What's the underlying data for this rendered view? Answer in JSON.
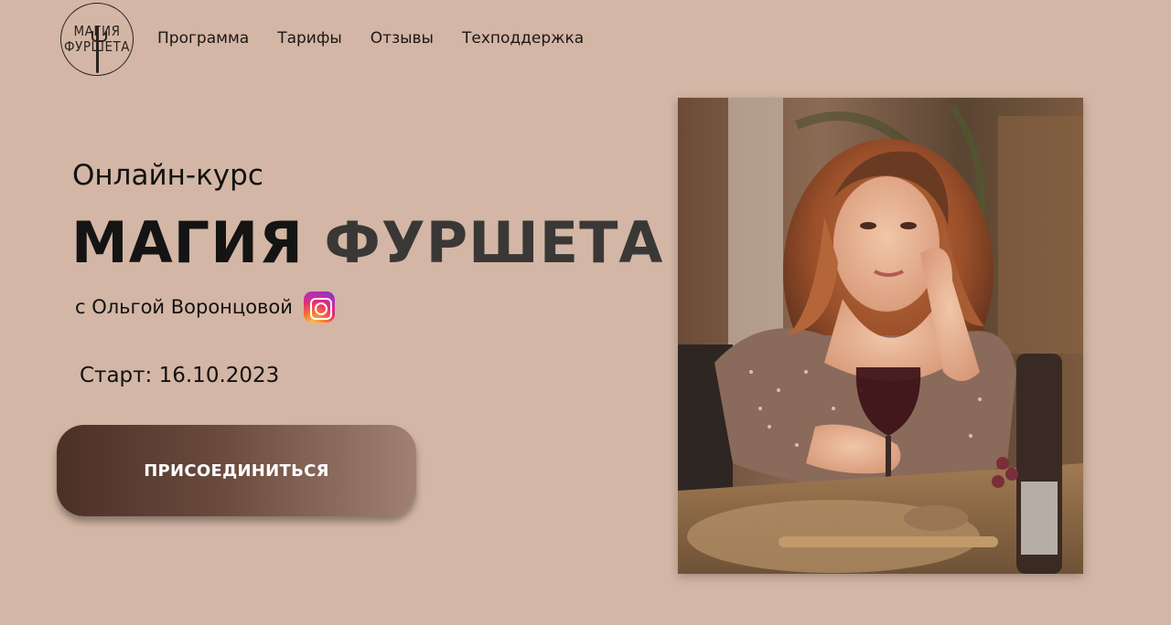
{
  "header": {
    "logo": {
      "line1": "МАГИЯ",
      "line2": "ФУРШЕТА"
    },
    "nav": [
      {
        "label": "Программа"
      },
      {
        "label": "Тарифы"
      },
      {
        "label": "Отзывы"
      },
      {
        "label": "Техподдержка"
      }
    ]
  },
  "hero": {
    "subtitle": "Онлайн-курс",
    "title_word1": "МАГИЯ",
    "title_word2": "ФУРШЕТА",
    "author": "с Ольгой Воронцовой",
    "author_icon": "instagram-icon",
    "start": "Старт: 16.10.2023",
    "cta_label": "ПРИСОЕДИНИТЬСЯ"
  },
  "colors": {
    "background": "#d3b6a5",
    "button_dark": "#4b3026",
    "button_light": "#a08172"
  },
  "photo": {
    "alt": "woman-with-wine-glass-photo"
  }
}
